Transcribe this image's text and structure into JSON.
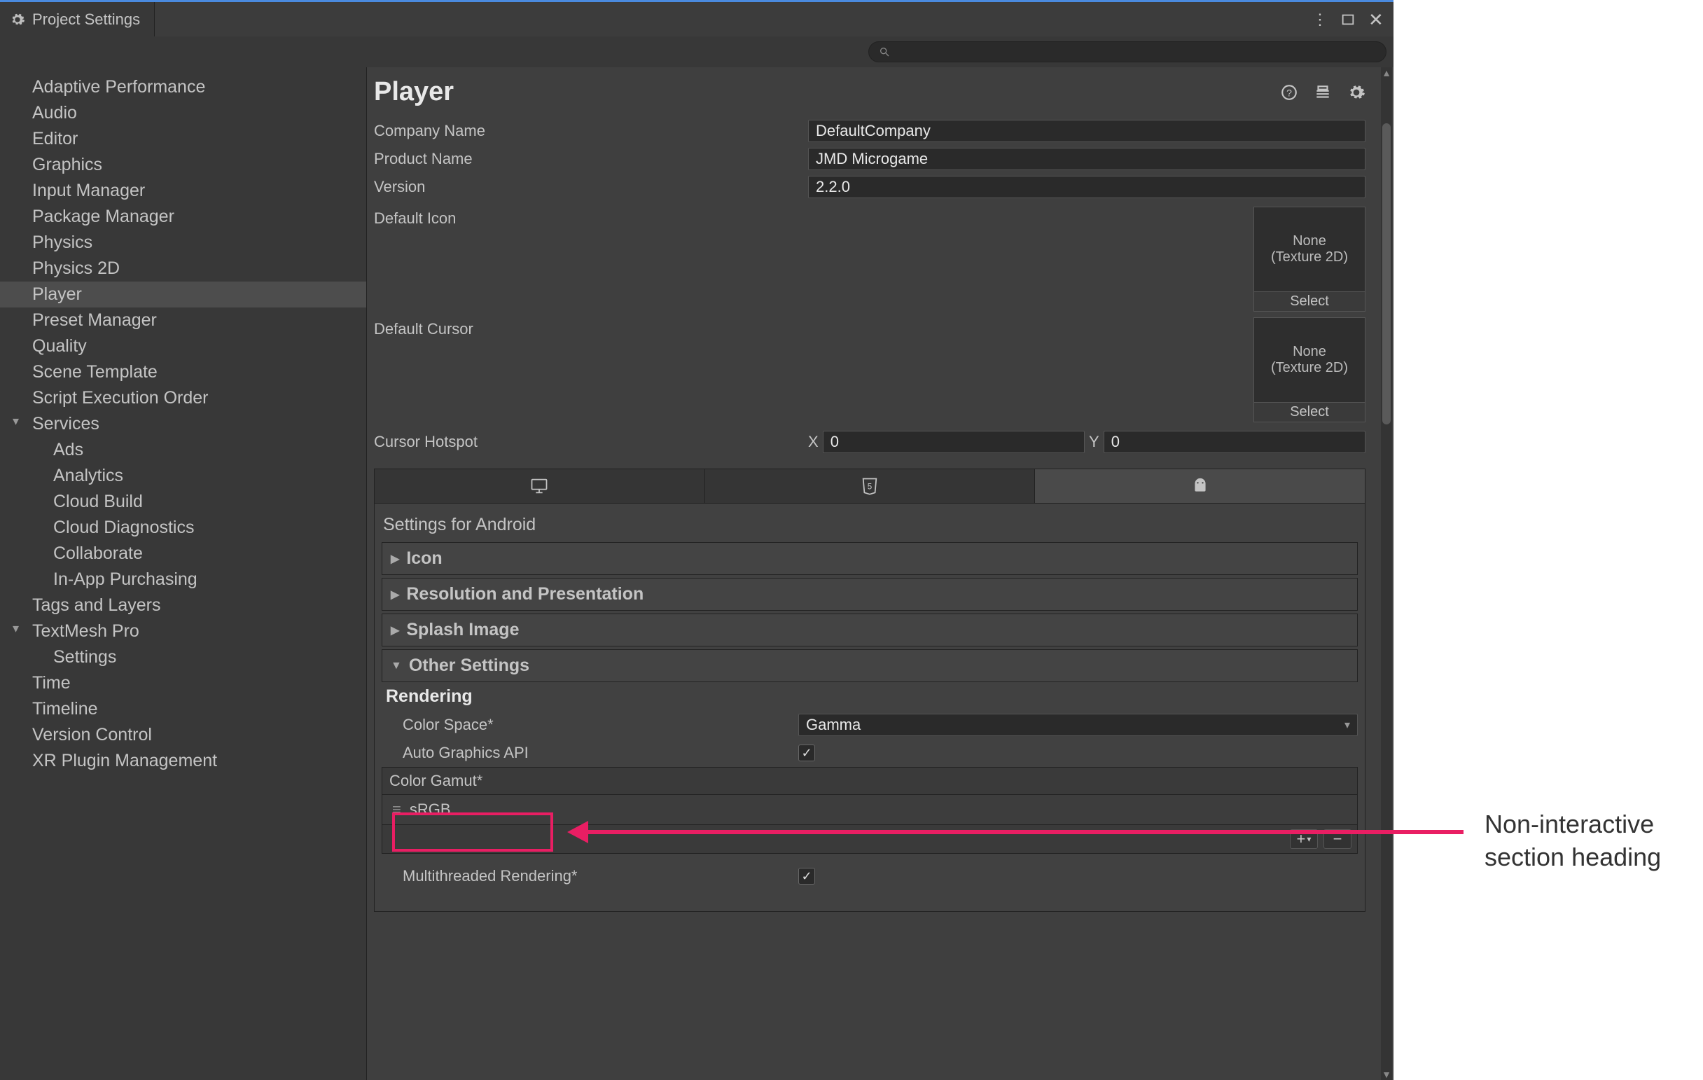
{
  "window": {
    "title": "Project Settings"
  },
  "sidebar": {
    "items": [
      {
        "label": "Adaptive Performance",
        "name": "sidebar-item-adaptive-performance"
      },
      {
        "label": "Audio",
        "name": "sidebar-item-audio"
      },
      {
        "label": "Editor",
        "name": "sidebar-item-editor"
      },
      {
        "label": "Graphics",
        "name": "sidebar-item-graphics"
      },
      {
        "label": "Input Manager",
        "name": "sidebar-item-input-manager"
      },
      {
        "label": "Package Manager",
        "name": "sidebar-item-package-manager"
      },
      {
        "label": "Physics",
        "name": "sidebar-item-physics"
      },
      {
        "label": "Physics 2D",
        "name": "sidebar-item-physics-2d"
      },
      {
        "label": "Player",
        "name": "sidebar-item-player",
        "selected": true
      },
      {
        "label": "Preset Manager",
        "name": "sidebar-item-preset-manager"
      },
      {
        "label": "Quality",
        "name": "sidebar-item-quality"
      },
      {
        "label": "Scene Template",
        "name": "sidebar-item-scene-template"
      },
      {
        "label": "Script Execution Order",
        "name": "sidebar-item-script-execution-order"
      },
      {
        "label": "Services",
        "name": "sidebar-item-services",
        "group": true
      },
      {
        "label": "Ads",
        "name": "sidebar-item-ads",
        "indent": true
      },
      {
        "label": "Analytics",
        "name": "sidebar-item-analytics",
        "indent": true
      },
      {
        "label": "Cloud Build",
        "name": "sidebar-item-cloud-build",
        "indent": true
      },
      {
        "label": "Cloud Diagnostics",
        "name": "sidebar-item-cloud-diagnostics",
        "indent": true
      },
      {
        "label": "Collaborate",
        "name": "sidebar-item-collaborate",
        "indent": true
      },
      {
        "label": "In-App Purchasing",
        "name": "sidebar-item-in-app-purchasing",
        "indent": true
      },
      {
        "label": "Tags and Layers",
        "name": "sidebar-item-tags-and-layers"
      },
      {
        "label": "TextMesh Pro",
        "name": "sidebar-item-textmesh-pro",
        "group": true
      },
      {
        "label": "Settings",
        "name": "sidebar-item-tmp-settings",
        "indent": true
      },
      {
        "label": "Time",
        "name": "sidebar-item-time"
      },
      {
        "label": "Timeline",
        "name": "sidebar-item-timeline"
      },
      {
        "label": "Version Control",
        "name": "sidebar-item-version-control"
      },
      {
        "label": "XR Plugin Management",
        "name": "sidebar-item-xr-plugin-management"
      }
    ]
  },
  "player": {
    "title": "Player",
    "company_name_label": "Company Name",
    "company_name": "DefaultCompany",
    "product_name_label": "Product Name",
    "product_name": "JMD Microgame",
    "version_label": "Version",
    "version": "2.2.0",
    "default_icon_label": "Default Icon",
    "default_cursor_label": "Default Cursor",
    "thumb_none": "None",
    "thumb_type": "(Texture 2D)",
    "thumb_select": "Select",
    "cursor_hotspot_label": "Cursor Hotspot",
    "hotspot_x_label": "X",
    "hotspot_x": "0",
    "hotspot_y_label": "Y",
    "hotspot_y": "0",
    "platform_section_label": "Settings for Android",
    "foldouts": {
      "icon": "Icon",
      "resolution": "Resolution and Presentation",
      "splash": "Splash Image",
      "other": "Other Settings"
    },
    "rendering": {
      "heading": "Rendering",
      "color_space_label": "Color Space*",
      "color_space": "Gamma",
      "auto_graphics_label": "Auto Graphics API",
      "auto_graphics": true,
      "color_gamut_label": "Color Gamut*",
      "color_gamut_item": "sRGB",
      "multithreaded_label": "Multithreaded Rendering*",
      "multithreaded": true,
      "add_label": "+",
      "remove_label": "−"
    }
  },
  "annotation": {
    "text_line1": "Non-interactive",
    "text_line2": "section heading"
  }
}
